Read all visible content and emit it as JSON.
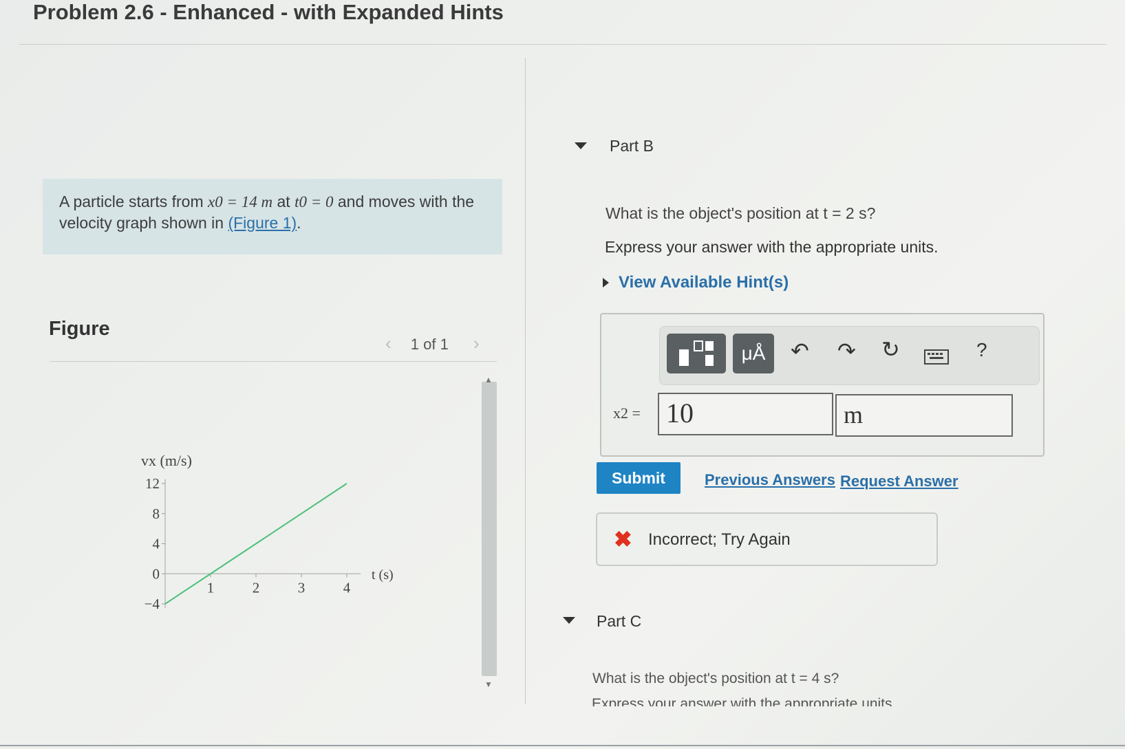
{
  "title": "Problem 2.6 - Enhanced - with Expanded Hints",
  "problem": {
    "text_before": "A particle starts from ",
    "x0_expr": "x0 = 14 m",
    "text_mid": " at ",
    "t0_expr": "t0 = 0",
    "text_after": " and moves with the velocity graph shown in ",
    "figure_link": "(Figure 1)",
    "period": "."
  },
  "figure": {
    "label": "Figure",
    "pager": "1 of 1"
  },
  "chart_data": {
    "type": "line",
    "ylabel": "vx (m/s)",
    "xlabel": "t (s)",
    "y_ticks": [
      "12",
      "8",
      "4",
      "0",
      "−4"
    ],
    "x_ticks": [
      "1",
      "2",
      "3",
      "4"
    ],
    "ylim": [
      -4,
      12
    ],
    "xlim": [
      0,
      4
    ],
    "series": [
      {
        "x": [
          0,
          1,
          4
        ],
        "y": [
          -4,
          0,
          12
        ],
        "color": "#4cc07a"
      }
    ]
  },
  "partB": {
    "title": "Part B",
    "question": "What is the object's position at t = 2 s?",
    "instruction": "Express your answer with the appropriate units.",
    "hint_toggle": "View Available Hint(s)",
    "toolbar": {
      "template_icon": "fraction-template-icon",
      "units_label": "μÅ",
      "undo_icon": "undo-icon",
      "redo_icon": "redo-icon",
      "reset_icon": "reset-icon",
      "keyboard_icon": "keyboard-icon",
      "help_label": "?"
    },
    "variable_label": "x2 =",
    "value": "10",
    "unit": "m",
    "submit_label": "Submit",
    "previous_answers": "Previous Answers",
    "request_answer": "Request Answer",
    "feedback": "Incorrect; Try Again",
    "feedback_color": "#e0301e"
  },
  "partC": {
    "title": "Part C",
    "question": "What is the object's position at t = 4 s?",
    "instruction": "Express your answer with the appropriate units."
  },
  "colors": {
    "accent": "#1f84c4",
    "link": "#2a6fa8",
    "problem_bg": "#d7e4e6",
    "graph_line": "#4cc07a"
  }
}
